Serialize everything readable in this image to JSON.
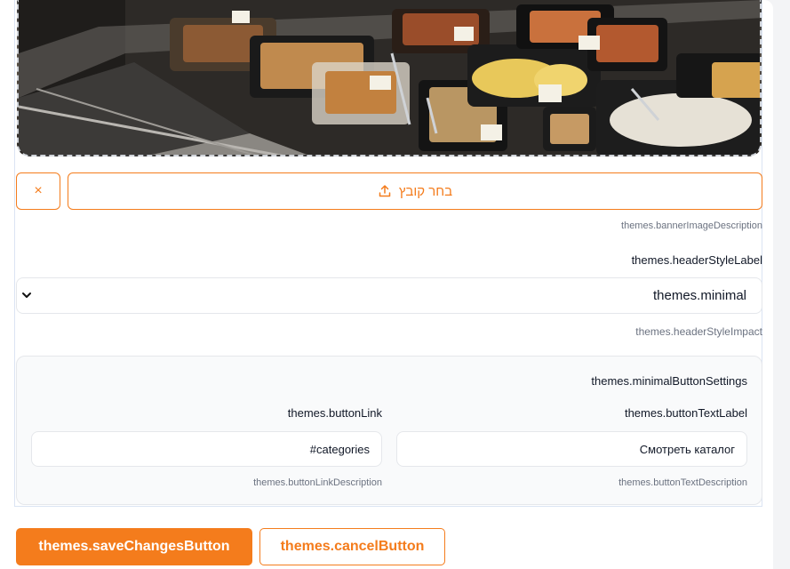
{
  "banner": {
    "image_name": "deli-display-case-photo"
  },
  "file_picker": {
    "choose_label": "בחר קובץ",
    "clear_symbol": "×",
    "upload_icon": "upload-icon",
    "description": "themes.bannerImageDescription"
  },
  "header_style": {
    "label": "themes.headerStyleLabel",
    "selected": "themes.minimal",
    "impact": "themes.headerStyleImpact"
  },
  "minimal_settings": {
    "title": "themes.minimalButtonSettings",
    "button_text": {
      "label": "themes.buttonTextLabel",
      "value": "Смотреть каталог",
      "description": "themes.buttonTextDescription"
    },
    "button_link": {
      "label": "themes.buttonLink",
      "value": "#categories",
      "description": "themes.buttonLinkDescription"
    }
  },
  "actions": {
    "save": "themes.saveChangesButton",
    "cancel": "themes.cancelButton"
  },
  "colors": {
    "accent": "#f47c1c",
    "border": "#e5e7eb",
    "card_bg": "#f9fafb"
  }
}
